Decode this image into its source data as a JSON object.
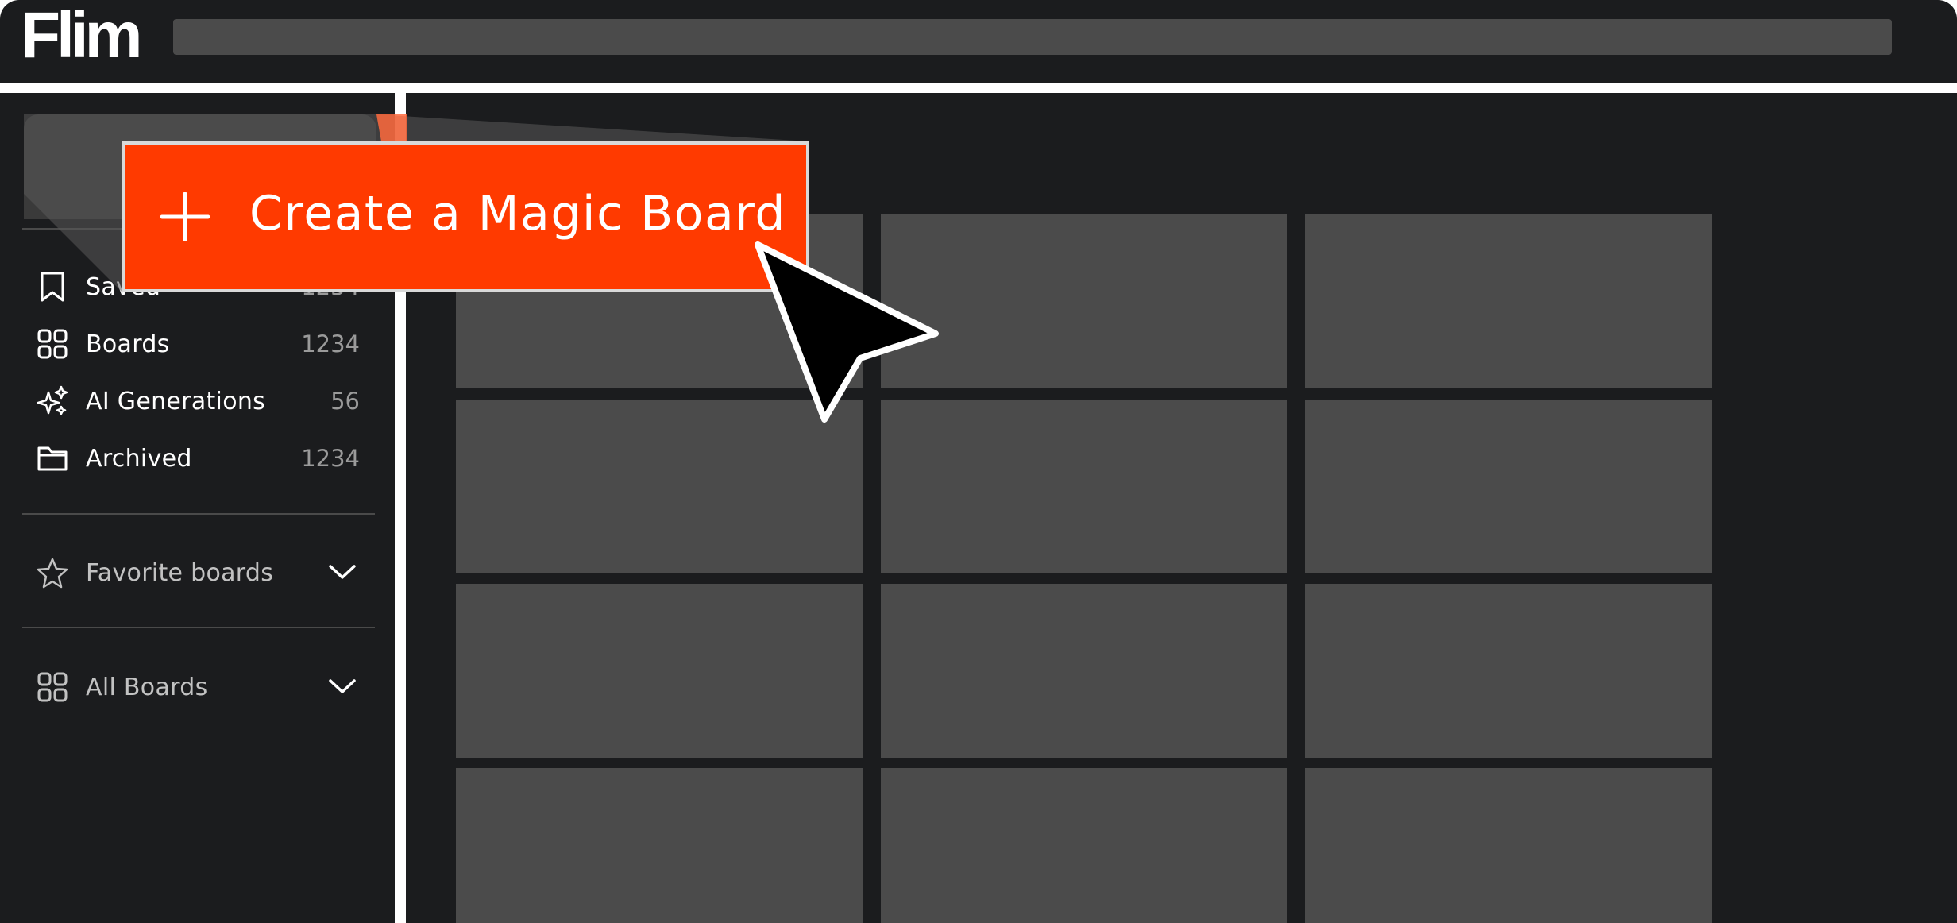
{
  "app": {
    "logo_text": "Flim"
  },
  "search": {
    "placeholder": ""
  },
  "sidebar": {
    "items": [
      {
        "label": "Saved",
        "count": "1234",
        "icon": "bookmark-icon"
      },
      {
        "label": "Boards",
        "count": "1234",
        "icon": "grid-icon"
      },
      {
        "label": "AI Generations",
        "count": "56",
        "icon": "sparkles-icon"
      },
      {
        "label": "Archived",
        "count": "1234",
        "icon": "folder-icon"
      }
    ],
    "sections": [
      {
        "label": "Favorite boards",
        "icon": "star-icon"
      },
      {
        "label": "All Boards",
        "icon": "grid-icon"
      }
    ]
  },
  "overlay": {
    "create_button_label": "Create a Magic Board",
    "accent_color": "#ff3a00"
  },
  "colors": {
    "background": "#1b1c1e",
    "placeholder": "#4b4b4b"
  }
}
